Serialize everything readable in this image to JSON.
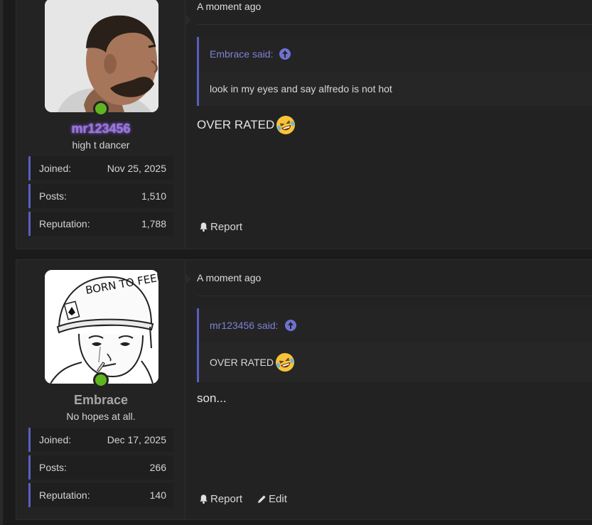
{
  "posts": [
    {
      "username": "mr123456",
      "user_title": "high t dancer",
      "stats": [
        {
          "label": "Joined:",
          "value": "Nov 25, 2025"
        },
        {
          "label": "Posts:",
          "value": "1,510"
        },
        {
          "label": "Reputation:",
          "value": "1,788"
        }
      ],
      "timestamp": "A moment ago",
      "quote": {
        "author": "Embrace said:",
        "text": "look in my eyes and say alfredo is not hot"
      },
      "message": "OVER RATED",
      "message_emoji": "rolling-on-floor-laughing-emoji",
      "actions": [
        {
          "label": "Report",
          "icon": "bell-icon"
        }
      ]
    },
    {
      "username": "Embrace",
      "user_title": "No hopes at all.",
      "stats": [
        {
          "label": "Joined:",
          "value": "Dec 17, 2025"
        },
        {
          "label": "Posts:",
          "value": "266"
        },
        {
          "label": "Reputation:",
          "value": "140"
        }
      ],
      "timestamp": "A moment ago",
      "quote": {
        "author": "mr123456 said:",
        "text": "OVER RATED",
        "emoji": "rolling-on-floor-laughing-emoji"
      },
      "message": "son...",
      "actions": [
        {
          "label": "Report",
          "icon": "bell-icon"
        },
        {
          "label": "Edit",
          "icon": "pencil-icon"
        }
      ]
    }
  ],
  "avatar_art_text": "BORN TO FEEL",
  "colors": {
    "accent": "#5a5ec0",
    "online": "#5fb520",
    "link": "#7d82d4",
    "username_glow": "#9b78d8"
  }
}
